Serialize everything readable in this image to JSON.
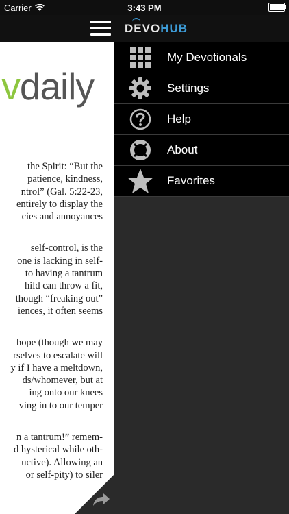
{
  "status_bar": {
    "carrier": "Carrier",
    "time": "3:43 PM"
  },
  "nav": {
    "logo_devo": "DEVO",
    "logo_hub": "HUB"
  },
  "article": {
    "brand_v": "v",
    "brand_rest": "daily",
    "paragraphs": [
      [
        "the Spirit: “But the",
        "patience, kindness,",
        "ntrol” (Gal. 5:22-23,",
        "entirely to display the",
        "cies and annoyances"
      ],
      [
        "self-control, is the",
        "one is lacking in self-",
        "to having a tantrum",
        "hild can throw a fit,",
        "though “freaking out”",
        "iences, it often seems"
      ],
      [
        "hope (though we may",
        "rselves to escalate will",
        "y if I have a meltdown,",
        "ds/whomever, but at",
        "ing onto our knees",
        "ving in to our temper"
      ],
      [
        "n a tantrum!” remem-",
        "d hysterical while oth-",
        "uctive). Allowing an",
        "or self-pity) to siler"
      ]
    ]
  },
  "menu": {
    "items": [
      {
        "label": "My Devotionals",
        "icon": "grid-icon"
      },
      {
        "label": "Settings",
        "icon": "gear-icon"
      },
      {
        "label": "Help",
        "icon": "question-icon"
      },
      {
        "label": "About",
        "icon": "lifebuoy-icon"
      },
      {
        "label": "Favorites",
        "icon": "star-icon"
      }
    ]
  },
  "colors": {
    "accent_blue": "#3d9bd6",
    "brand_green": "#8dc63f",
    "menu_bg": "#000000",
    "panel_bg": "#2a2a2a"
  }
}
